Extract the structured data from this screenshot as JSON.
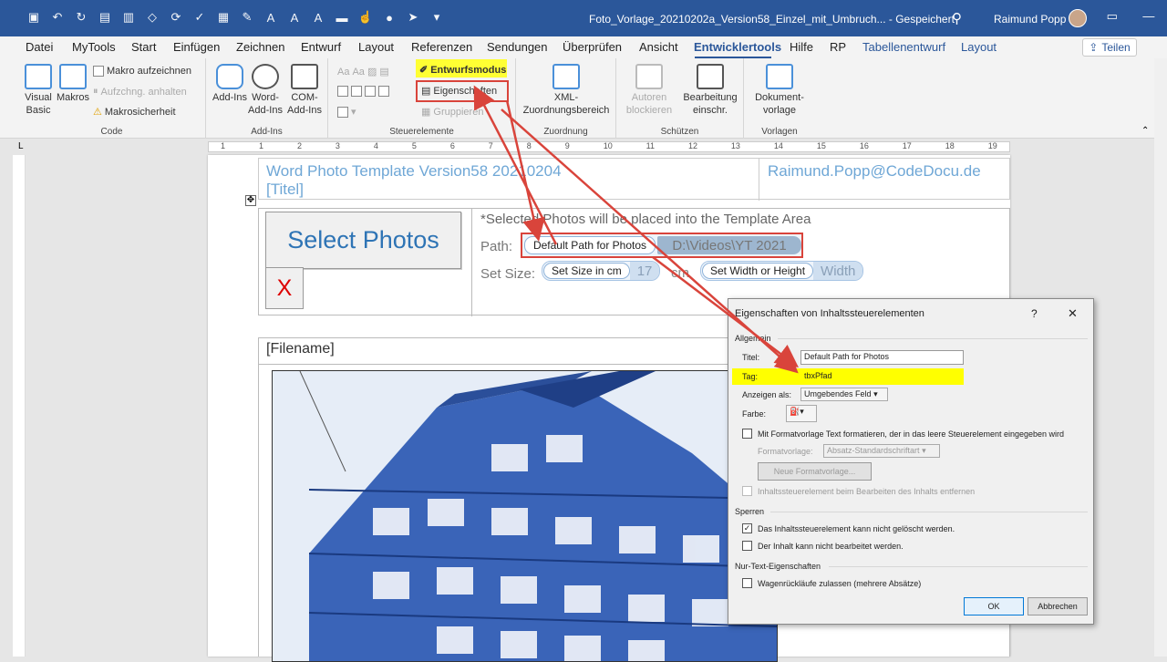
{
  "titlebar": {
    "doc_title": "Foto_Vorlage_20210202a_Version58_Einzel_mit_Umbruch... - Gespeichert",
    "user_name": "Raimund Popp",
    "qat_icons": [
      "save-icon",
      "undo-icon",
      "redo-icon",
      "print-preview-icon",
      "form-icon",
      "document-icon",
      "shapes-icon",
      "refresh-icon",
      "check-icon",
      "table-icon",
      "highlight-icon",
      "font-grow-icon",
      "font-shrink-icon",
      "font-color-icon",
      "shading-icon",
      "touch-icon",
      "microphone-icon",
      "dictate-icon",
      "pointer-icon",
      "customize-icon"
    ]
  },
  "tabs": [
    "Datei",
    "MyTools",
    "Start",
    "Einfügen",
    "Zeichnen",
    "Entwurf",
    "Layout",
    "Referenzen",
    "Sendungen",
    "Überprüfen",
    "Ansicht",
    "Entwicklertools",
    "Hilfe",
    "RP",
    "Tabellenentwurf",
    "Layout"
  ],
  "active_tab": "Entwicklertools",
  "share_label": "Teilen",
  "ribbon": {
    "code": {
      "label": "Code",
      "visual_basic": "Visual Basic",
      "makros": "Makros",
      "record": "Makro aufzeichnen",
      "pause": "Aufzchng. anhalten",
      "security": "Makrosicherheit"
    },
    "addins": {
      "label": "Add-Ins",
      "addins": "Add-Ins",
      "word_addins": "Word-Add-Ins",
      "com_addins": "COM-Add-Ins"
    },
    "controls": {
      "label": "Steuerelemente",
      "design_mode": "Entwurfsmodus",
      "properties": "Eigenschaften",
      "group": "Gruppieren"
    },
    "mapping": {
      "label": "Zuordnung",
      "xml": "XML-Zuordnungsbereich"
    },
    "protect": {
      "label": "Schützen",
      "authors": "Autoren blockieren",
      "restrict": "Bearbeitung einschr."
    },
    "templates": {
      "label": "Vorlagen",
      "doc_template": "Dokument-vorlage"
    }
  },
  "ruler_numbers": [
    "1",
    "1",
    "2",
    "3",
    "4",
    "5",
    "6",
    "7",
    "8",
    "9",
    "10",
    "11",
    "12",
    "13",
    "14",
    "15",
    "16",
    "17",
    "18",
    "19"
  ],
  "document": {
    "header_left_1": "Word Photo Template Version58 20210204",
    "header_left_2": "[Titel]",
    "header_right": "Raimund.Popp@CodeDocu.de",
    "select_photos": "Select Photos",
    "x_label": "X",
    "note": "*Selected Photos will be placed into the Template Area",
    "path_label": "Path:",
    "path_cc_title": "Default Path for Photos",
    "path_cc_value": "D:\\Videos\\YT 2021",
    "size_label": "Set Size:",
    "size_cc_title": "Set Size in cm",
    "size_cc_value": "17",
    "cm_label": "cm",
    "width_cc_title": "Set Width or Height",
    "width_cc_value": "Width",
    "filename": "[Filename]"
  },
  "dialog": {
    "title": "Eigenschaften von Inhaltssteuerelementen",
    "help": "?",
    "close": "✕",
    "section_general": "Allgemein",
    "title_label": "Titel:",
    "title_value": "Default Path for Photos",
    "tag_label": "Tag:",
    "tag_value": "tbxPfad",
    "show_as_label": "Anzeigen als:",
    "show_as_value": "Umgebendes Feld",
    "color_label": "Farbe:",
    "use_style": "Mit Formatvorlage Text formatieren, der in das leere Steuerelement eingegeben wird",
    "style_label": "Formatvorlage:",
    "style_value": "Absatz-Standardschriftart",
    "new_style": "Neue Formatvorlage...",
    "remove_cc": "Inhaltssteuerelement beim Bearbeiten des Inhalts entfernen",
    "section_lock": "Sperren",
    "lock_delete": "Das Inhaltssteuerelement kann nicht gelöscht werden.",
    "lock_edit": "Der Inhalt kann nicht bearbeitet werden.",
    "section_plain": "Nur-Text-Eigenschaften",
    "allow_returns": "Wagenrückläufe zulassen (mehrere Absätze)",
    "ok": "OK",
    "cancel": "Abbrechen",
    "lock_delete_checked": true,
    "lock_edit_checked": false
  },
  "colors": {
    "accent": "#2b579a",
    "highlight": "#ffff00",
    "annotation": "#d9443b",
    "cc_text": "#6fa7d6"
  }
}
